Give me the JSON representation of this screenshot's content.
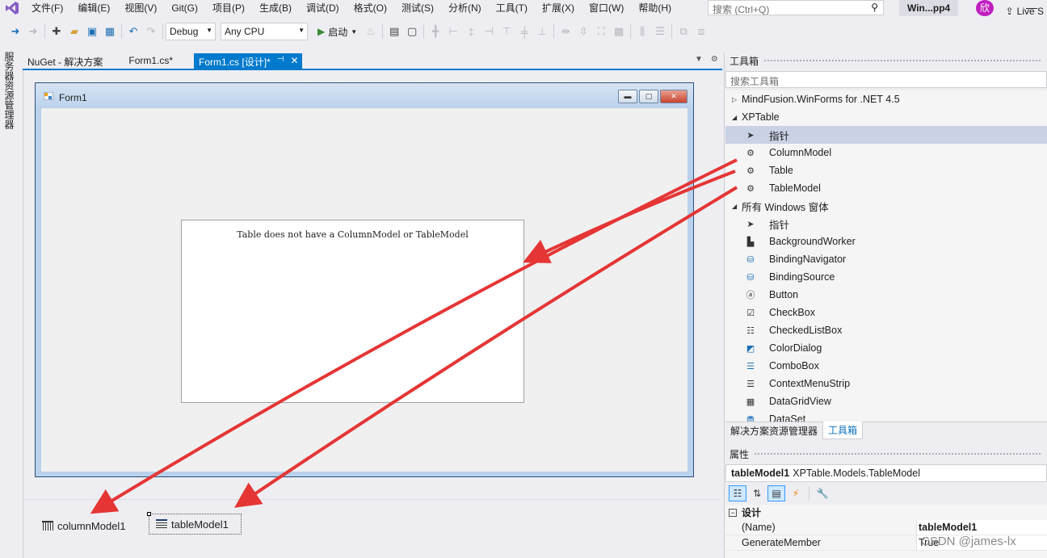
{
  "menu": {
    "items": [
      "文件(F)",
      "编辑(E)",
      "视图(V)",
      "Git(G)",
      "项目(P)",
      "生成(B)",
      "调试(D)",
      "格式(O)",
      "测试(S)",
      "分析(N)",
      "工具(T)",
      "扩展(X)",
      "窗口(W)",
      "帮助(H)"
    ],
    "search_placeholder": "搜索 (Ctrl+Q)",
    "solution_title": "Win...pp4",
    "user_initial": "欣"
  },
  "toolbar": {
    "config": "Debug",
    "platform": "Any CPU",
    "start_label": "启动",
    "live_share": "Live S"
  },
  "left_tab": "服务器资源管理器",
  "doc_tabs": [
    {
      "label": "NuGet - 解决方案",
      "active": false
    },
    {
      "label": "Form1.cs*",
      "active": false
    },
    {
      "label": "Form1.cs [设计]*",
      "active": true
    }
  ],
  "form": {
    "title": "Form1",
    "table_message": "Table does not have a ColumnModel or TableModel"
  },
  "tray": {
    "column_model": "columnModel1",
    "table_model": "tableModel1"
  },
  "toolbox": {
    "title": "工具箱",
    "search_placeholder": "搜索工具箱",
    "groups": [
      {
        "label": "MindFusion.WinForms for .NET 4.5",
        "expanded": false
      },
      {
        "label": "XPTable",
        "expanded": true
      },
      {
        "label": "所有 Windows 窗体",
        "expanded": true
      }
    ],
    "xptable_tools": [
      "指针",
      "ColumnModel",
      "Table",
      "TableModel"
    ],
    "windows_tools": [
      "指针",
      "BackgroundWorker",
      "BindingNavigator",
      "BindingSource",
      "Button",
      "CheckBox",
      "CheckedListBox",
      "ColorDialog",
      "ComboBox",
      "ContextMenuStrip",
      "DataGridView",
      "DataSet"
    ]
  },
  "panel_tabs": [
    "解决方案资源管理器",
    "工具箱"
  ],
  "properties": {
    "title": "属性",
    "object_name": "tableModel1",
    "object_type": "XPTable.Models.TableModel",
    "category": "设计",
    "rows": [
      {
        "name": "(Name)",
        "value": "tableModel1"
      },
      {
        "name": "GenerateMember",
        "value": "True"
      }
    ]
  },
  "watermark": "CSDN @james-lx",
  "colors": {
    "accent": "#007acc",
    "annotation_arrow": "#e53535"
  }
}
